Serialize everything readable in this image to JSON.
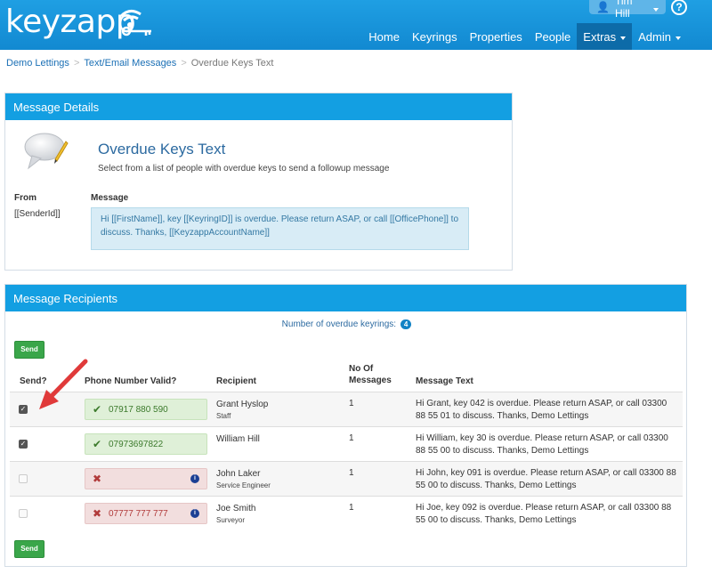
{
  "header": {
    "logo_text": "keyzapp",
    "user_name": "Tim Hill",
    "help_symbol": "?",
    "nav": [
      {
        "label": "Home",
        "dropdown": false,
        "active": false
      },
      {
        "label": "Keyrings",
        "dropdown": false,
        "active": false
      },
      {
        "label": "Properties",
        "dropdown": false,
        "active": false
      },
      {
        "label": "People",
        "dropdown": false,
        "active": false
      },
      {
        "label": "Extras",
        "dropdown": true,
        "active": true
      },
      {
        "label": "Admin",
        "dropdown": true,
        "active": false
      }
    ]
  },
  "breadcrumb": {
    "items": [
      "Demo Lettings",
      "Text/Email Messages"
    ],
    "separator": ">",
    "current": "Overdue Keys Text"
  },
  "message_details": {
    "heading": "Message Details",
    "title": "Overdue Keys Text",
    "subtitle": "Select from a list of people with overdue keys to send a followup message",
    "from_label": "From",
    "from_value": "[[SenderId]]",
    "message_label": "Message",
    "message_text": "Hi [[FirstName]], key [[KeyringID]] is overdue. Please return ASAP, or call [[OfficePhone]] to discuss. Thanks, [[KeyzappAccountName]]"
  },
  "recipients": {
    "heading": "Message Recipients",
    "count_label": "Number of overdue keyrings:",
    "count": "4",
    "send_label": "Send",
    "columns": {
      "send": "Send?",
      "phone_valid": "Phone Number Valid?",
      "recipient": "Recipient",
      "no_messages": "No Of Messages",
      "message_text": "Message Text"
    },
    "rows": [
      {
        "checked": true,
        "enabled": true,
        "phone_valid": true,
        "phone": "07917 880 590",
        "name": "Grant Hyslop",
        "role": "Staff",
        "count": "1",
        "message": "Hi Grant, key 042 is overdue. Please return ASAP, or call 03300 88 55 01 to discuss. Thanks, Demo Lettings"
      },
      {
        "checked": true,
        "enabled": true,
        "phone_valid": true,
        "phone": "07973697822",
        "name": "William Hill",
        "role": "",
        "count": "1",
        "message": "Hi William, key 30 is overdue. Please return ASAP, or call 03300 88 55 00 to discuss. Thanks, Demo Lettings"
      },
      {
        "checked": false,
        "enabled": false,
        "phone_valid": false,
        "phone": "",
        "name": "John Laker",
        "role": "Service Engineer",
        "count": "1",
        "message": "Hi John, key 091 is overdue. Please return ASAP, or call 03300 88 55 00 to discuss. Thanks, Demo Lettings"
      },
      {
        "checked": false,
        "enabled": false,
        "phone_valid": false,
        "phone": "07777 777 777",
        "name": "Joe Smith",
        "role": "Surveyor",
        "count": "1",
        "message": "Hi Joe, key 092 is overdue. Please return ASAP, or call 03300 88 55 00 to discuss. Thanks, Demo Lettings"
      }
    ]
  },
  "colors": {
    "header_blue": "#139fe2",
    "nav_active": "#0d6ba8",
    "send_green": "#3aa64a",
    "valid_green": "#dff0d8",
    "invalid_red": "#f2dede",
    "arrow_red": "#e03a3a"
  },
  "icons": [
    "wifi-key-logo-icon",
    "user-icon",
    "help-icon",
    "speech-bubble-icon",
    "check-icon",
    "cross-icon",
    "info-icon"
  ]
}
